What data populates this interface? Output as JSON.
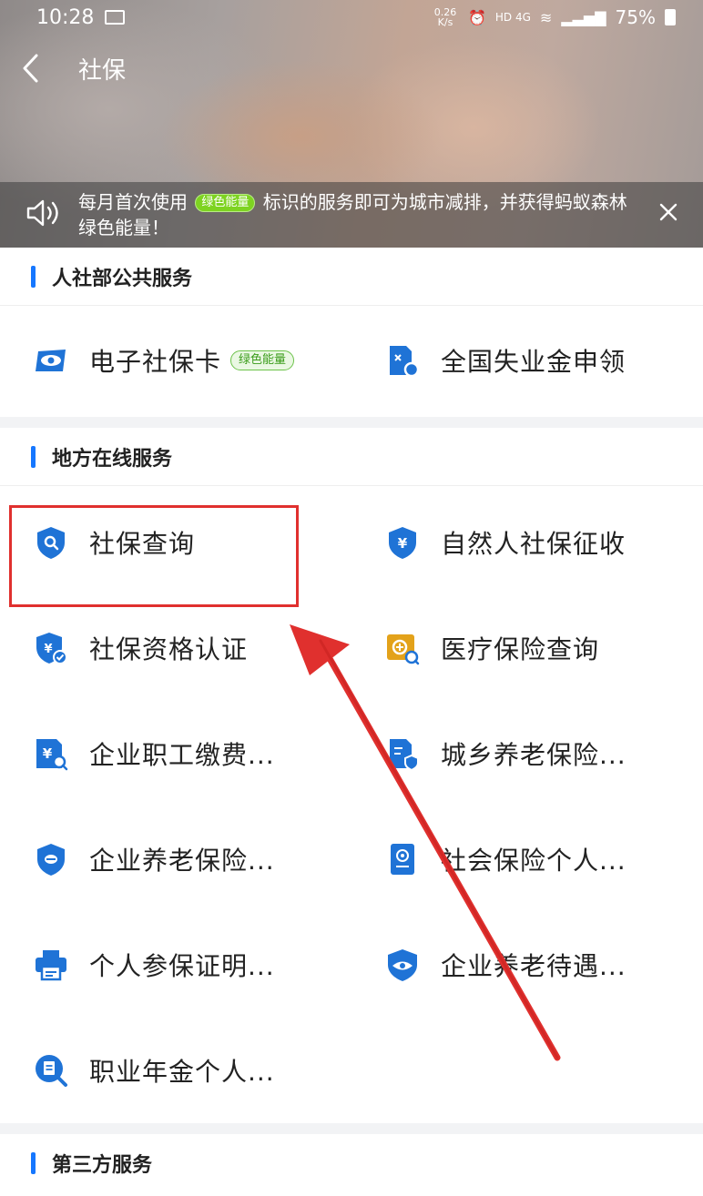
{
  "status_bar": {
    "time": "10:28",
    "net_speed": "0.26 K/s",
    "signal": "HD 4G",
    "battery": "75%"
  },
  "nav": {
    "title": "社保",
    "back_icon": "chevron-left-icon"
  },
  "notice": {
    "text_before": "每月首次使用",
    "tag": "绿色能量",
    "text_after": "标识的服务即可为城市减排，并获得蚂蚁森林绿色能量！"
  },
  "sections": [
    {
      "title": "人社部公共服务",
      "items": [
        {
          "label": "电子社保卡",
          "tag": "绿色能量",
          "icon": "eye-card-icon"
        },
        {
          "label": "全国失业金申领",
          "icon": "document-coin-icon"
        }
      ]
    },
    {
      "title": "地方在线服务",
      "items": [
        {
          "label": "社保查询",
          "icon": "shield-search-icon"
        },
        {
          "label": "自然人社保征收",
          "icon": "shield-yen-icon"
        },
        {
          "label": "社保资格认证",
          "icon": "shield-check-icon"
        },
        {
          "label": "医疗保险查询",
          "icon": "medical-search-icon"
        },
        {
          "label": "企业职工缴费...",
          "icon": "yen-search-icon"
        },
        {
          "label": "城乡养老保险...",
          "icon": "document-shield-icon"
        },
        {
          "label": "企业养老保险...",
          "icon": "shield-minus-icon"
        },
        {
          "label": "社会保险个人...",
          "icon": "id-card-icon"
        },
        {
          "label": "个人参保证明...",
          "icon": "printer-icon"
        },
        {
          "label": "企业养老待遇...",
          "icon": "shield-eye-icon"
        },
        {
          "label": "职业年金个人...",
          "icon": "doc-search-icon"
        }
      ]
    },
    {
      "title": "第三方服务",
      "items": []
    }
  ],
  "colors": {
    "accent": "#1677ff",
    "highlight": "#e0302e",
    "green_tag": "#7ed321"
  }
}
